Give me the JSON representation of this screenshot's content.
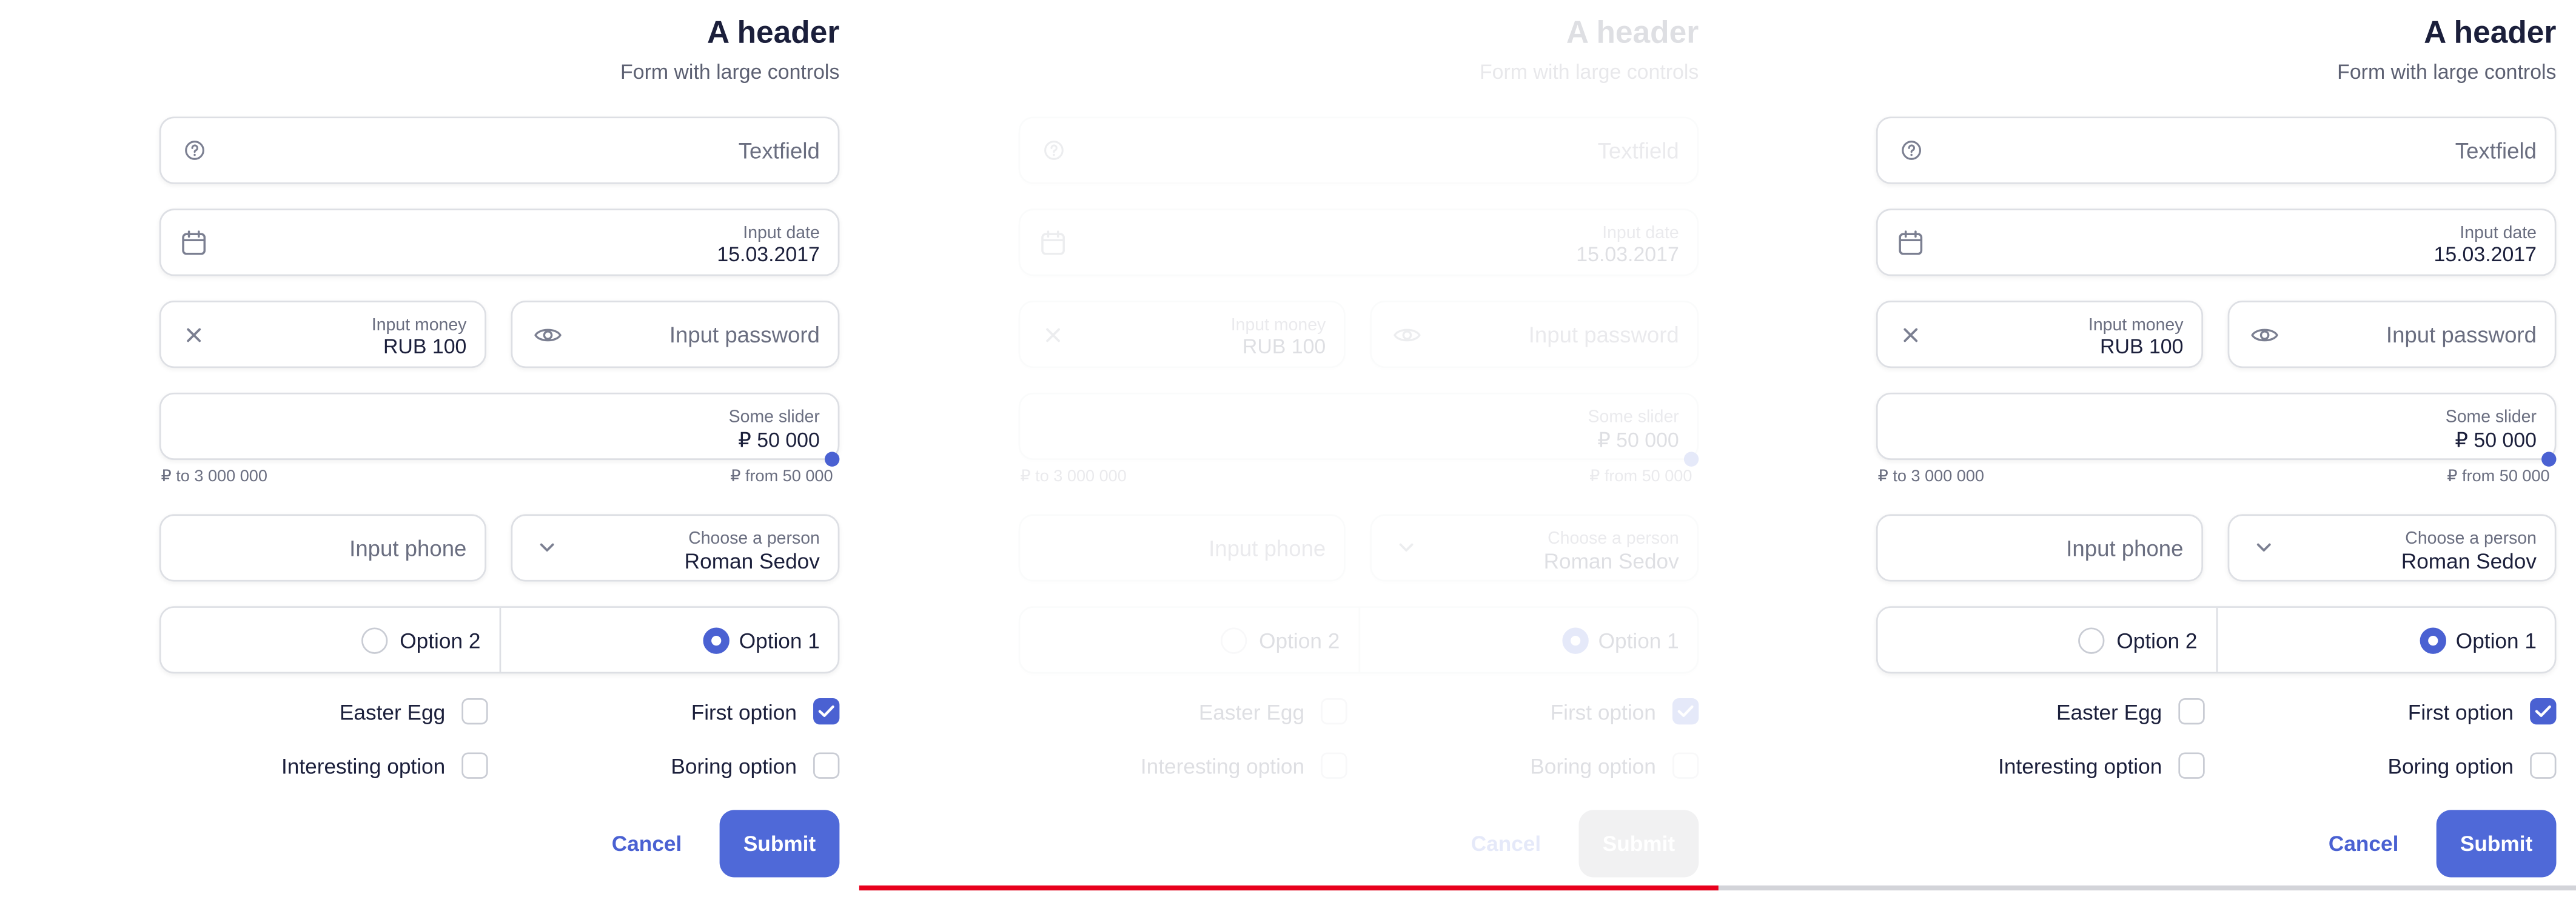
{
  "form": {
    "title": "A header",
    "subtitle": "Form with large controls",
    "textfield": {
      "placeholder": "Textfield",
      "icon": "question-circle-icon"
    },
    "date": {
      "label": "Input date",
      "value": "15.03.2017",
      "icon": "calendar-icon"
    },
    "money": {
      "label": "Input money",
      "value": "RUB 100",
      "icon": "close-icon"
    },
    "password": {
      "placeholder": "Input password",
      "icon": "eye-icon"
    },
    "slider": {
      "label": "Some slider",
      "value": "₽ 50 000",
      "min_text": "₽ to 3 000 000",
      "max_text": "₽ from 50 000"
    },
    "phone": {
      "placeholder": "Input phone"
    },
    "person": {
      "label": "Choose a person",
      "value": "Roman Sedov",
      "icon": "chevron-down-icon"
    },
    "radios": [
      {
        "label": "Option 2",
        "checked": false
      },
      {
        "label": "Option 1",
        "checked": true
      }
    ],
    "checkboxes": {
      "easter_egg": {
        "label": "Easter Egg",
        "checked": false
      },
      "first_option": {
        "label": "First option",
        "checked": true
      },
      "interesting_option": {
        "label": "Interesting option",
        "checked": false
      },
      "boring_option": {
        "label": "Boring option",
        "checked": false
      }
    },
    "cancel_label": "Cancel",
    "submit_label": "Submit"
  },
  "progress": {
    "fraction": 0.5
  },
  "colors": {
    "accent": "#4a61d2",
    "text": "#1b1f3b",
    "muted": "#6a6e80",
    "border": "#dddfe4",
    "progress_fill": "#e8001c",
    "progress_track": "#d3d4d9"
  }
}
